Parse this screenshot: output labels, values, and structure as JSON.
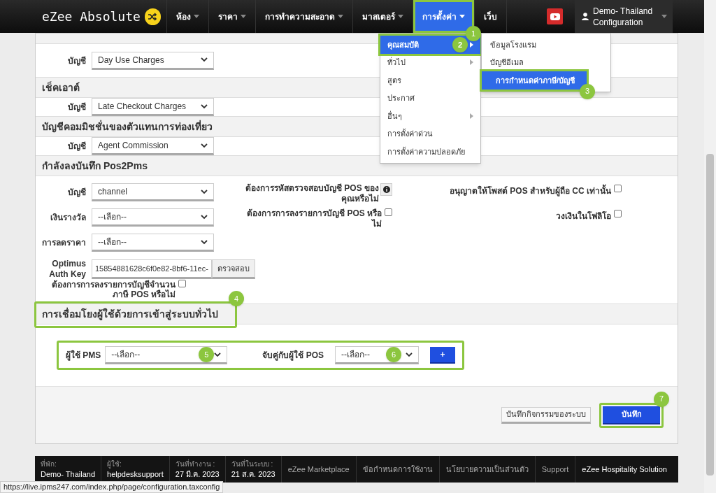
{
  "navbar": {
    "logo": "eZee Absolute",
    "menu": [
      {
        "label": "ห้อง",
        "caret": true,
        "selected": false
      },
      {
        "label": "ราคา",
        "caret": true,
        "selected": false
      },
      {
        "label": "การทำความสะอาด",
        "caret": true,
        "selected": false
      },
      {
        "label": "มาสเตอร์",
        "caret": true,
        "selected": false
      },
      {
        "label": "การตั้งค่า",
        "caret": true,
        "selected": true,
        "callout": "1"
      },
      {
        "label": "เว็บ",
        "caret": false,
        "selected": false
      }
    ],
    "user": {
      "name": "Demo- Thailand",
      "role": "Configuration"
    }
  },
  "dropdown": {
    "items": [
      {
        "label": "คุณสมบัติ",
        "submenu": true,
        "selected": true,
        "callout": "2"
      },
      {
        "label": "ทั่วไป",
        "submenu": true,
        "selected": false
      },
      {
        "label": "สูตร",
        "submenu": false,
        "selected": false
      },
      {
        "label": "ประกาศ",
        "submenu": false,
        "selected": false
      },
      {
        "label": "อื่นๆ",
        "submenu": true,
        "selected": false
      },
      {
        "label": "การตั้งค่าด่วน",
        "submenu": false,
        "selected": false
      },
      {
        "label": "การตั้งค่าความปลอดภัย",
        "submenu": false,
        "selected": false
      }
    ],
    "submenu": [
      {
        "label": "ข้อมูลโรงแรม",
        "selected": false
      },
      {
        "label": "บัญชีอีเมล",
        "selected": false
      },
      {
        "label": "การกำหนดค่าภาษี/บัญชี",
        "selected": true,
        "callout": "3"
      }
    ]
  },
  "sections": [
    {
      "label": "บัญชี",
      "value": "Day Use Charges"
    },
    {
      "title": "เช็คเอาต์",
      "label": "บัญชี",
      "value": "Late Checkout Charges"
    },
    {
      "title": "บัญชีคอมมิชชั่นของตัวแทนการท่องเที่ยว",
      "label": "บัญชี",
      "value": "Agent Commission"
    }
  ],
  "pos2pms": {
    "title": "กำลังลงบันทึก Pos2Pms",
    "fields": [
      {
        "label": "บัญชี",
        "value": "channel"
      },
      {
        "label": "เงินรางวัล",
        "value": "--เลือก--"
      },
      {
        "label": "การลดราคา",
        "value": "--เลือก--"
      }
    ],
    "auth": {
      "label": "Optimus Auth Key",
      "value": "15854881628c6f0e82-8bf6-11ec-",
      "button": "ตรวจสอบ"
    },
    "tax_option": {
      "label": "ต้องการการลงรายการบัญชีจำนวนภาษี POS หรือไม่",
      "checked": false
    },
    "middle": [
      {
        "label": "ต้องการรหัสตรวจสอบบัญชี POS ของคุณหรือไม่",
        "kind": "info"
      },
      {
        "label": "ต้องการการลงรายการบัญชี POS หรือไม่",
        "kind": "checkbox",
        "checked": false
      }
    ],
    "right": [
      {
        "label": "อนุญาตให้โพสต์ POS สำหรับผู้ถือ CC เท่านั้น",
        "checked": false
      },
      {
        "label": "วงเงินในโฟลิโอ",
        "checked": false
      }
    ]
  },
  "linking": {
    "title": "การเชื่อมโยงผู้ใช้ด้วยการเข้าสู่ระบบทั่วไป",
    "callout": "4",
    "pms_label": "ผู้ใช้ PMS",
    "pms_value": "--เลือก--",
    "pms_callout": "5",
    "pos_label": "จับคู่กับผู้ใช้ POS",
    "pos_value": "--เลือก--",
    "pos_callout": "6",
    "add": "+"
  },
  "actions": {
    "log": "บันทึกกิจกรรมของระบบ",
    "save": "บันทึก",
    "save_callout": "7"
  },
  "footer": {
    "info": [
      {
        "label": "ที่พัก:",
        "value": "Demo- Thailand"
      },
      {
        "label": "ผู้ใช้:",
        "value": "helpdesksupport"
      },
      {
        "label": "วันที่ทำงาน :",
        "value": "27 มี.ค. 2023"
      },
      {
        "label": "วันที่ในระบบ :",
        "value": "21 ส.ค. 2023"
      }
    ],
    "links": [
      "eZee Marketplace",
      "ข้อกำหนดการใช้งาน",
      "นโยบายความเป็นส่วนตัว",
      "Support"
    ],
    "brand": "eZee Hospitality Solution"
  },
  "status_url": "https://live.ipms247.com/index.php/page/configuration.taxconfig"
}
